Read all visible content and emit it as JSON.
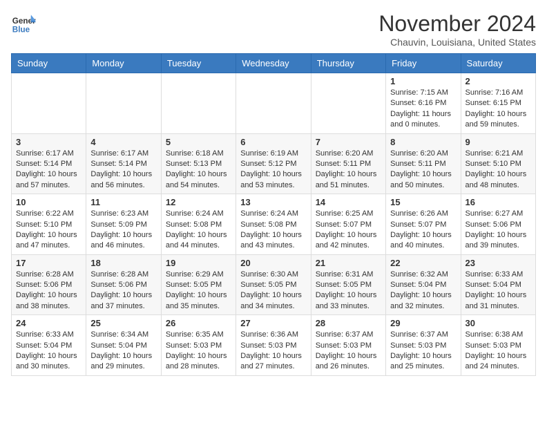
{
  "header": {
    "logo_general": "General",
    "logo_blue": "Blue",
    "month_title": "November 2024",
    "location": "Chauvin, Louisiana, United States"
  },
  "weekdays": [
    "Sunday",
    "Monday",
    "Tuesday",
    "Wednesday",
    "Thursday",
    "Friday",
    "Saturday"
  ],
  "weeks": [
    [
      {
        "day": "",
        "info": ""
      },
      {
        "day": "",
        "info": ""
      },
      {
        "day": "",
        "info": ""
      },
      {
        "day": "",
        "info": ""
      },
      {
        "day": "",
        "info": ""
      },
      {
        "day": "1",
        "info": "Sunrise: 7:15 AM\nSunset: 6:16 PM\nDaylight: 11 hours and 0 minutes."
      },
      {
        "day": "2",
        "info": "Sunrise: 7:16 AM\nSunset: 6:15 PM\nDaylight: 10 hours and 59 minutes."
      }
    ],
    [
      {
        "day": "3",
        "info": "Sunrise: 6:17 AM\nSunset: 5:14 PM\nDaylight: 10 hours and 57 minutes."
      },
      {
        "day": "4",
        "info": "Sunrise: 6:17 AM\nSunset: 5:14 PM\nDaylight: 10 hours and 56 minutes."
      },
      {
        "day": "5",
        "info": "Sunrise: 6:18 AM\nSunset: 5:13 PM\nDaylight: 10 hours and 54 minutes."
      },
      {
        "day": "6",
        "info": "Sunrise: 6:19 AM\nSunset: 5:12 PM\nDaylight: 10 hours and 53 minutes."
      },
      {
        "day": "7",
        "info": "Sunrise: 6:20 AM\nSunset: 5:11 PM\nDaylight: 10 hours and 51 minutes."
      },
      {
        "day": "8",
        "info": "Sunrise: 6:20 AM\nSunset: 5:11 PM\nDaylight: 10 hours and 50 minutes."
      },
      {
        "day": "9",
        "info": "Sunrise: 6:21 AM\nSunset: 5:10 PM\nDaylight: 10 hours and 48 minutes."
      }
    ],
    [
      {
        "day": "10",
        "info": "Sunrise: 6:22 AM\nSunset: 5:10 PM\nDaylight: 10 hours and 47 minutes."
      },
      {
        "day": "11",
        "info": "Sunrise: 6:23 AM\nSunset: 5:09 PM\nDaylight: 10 hours and 46 minutes."
      },
      {
        "day": "12",
        "info": "Sunrise: 6:24 AM\nSunset: 5:08 PM\nDaylight: 10 hours and 44 minutes."
      },
      {
        "day": "13",
        "info": "Sunrise: 6:24 AM\nSunset: 5:08 PM\nDaylight: 10 hours and 43 minutes."
      },
      {
        "day": "14",
        "info": "Sunrise: 6:25 AM\nSunset: 5:07 PM\nDaylight: 10 hours and 42 minutes."
      },
      {
        "day": "15",
        "info": "Sunrise: 6:26 AM\nSunset: 5:07 PM\nDaylight: 10 hours and 40 minutes."
      },
      {
        "day": "16",
        "info": "Sunrise: 6:27 AM\nSunset: 5:06 PM\nDaylight: 10 hours and 39 minutes."
      }
    ],
    [
      {
        "day": "17",
        "info": "Sunrise: 6:28 AM\nSunset: 5:06 PM\nDaylight: 10 hours and 38 minutes."
      },
      {
        "day": "18",
        "info": "Sunrise: 6:28 AM\nSunset: 5:06 PM\nDaylight: 10 hours and 37 minutes."
      },
      {
        "day": "19",
        "info": "Sunrise: 6:29 AM\nSunset: 5:05 PM\nDaylight: 10 hours and 35 minutes."
      },
      {
        "day": "20",
        "info": "Sunrise: 6:30 AM\nSunset: 5:05 PM\nDaylight: 10 hours and 34 minutes."
      },
      {
        "day": "21",
        "info": "Sunrise: 6:31 AM\nSunset: 5:05 PM\nDaylight: 10 hours and 33 minutes."
      },
      {
        "day": "22",
        "info": "Sunrise: 6:32 AM\nSunset: 5:04 PM\nDaylight: 10 hours and 32 minutes."
      },
      {
        "day": "23",
        "info": "Sunrise: 6:33 AM\nSunset: 5:04 PM\nDaylight: 10 hours and 31 minutes."
      }
    ],
    [
      {
        "day": "24",
        "info": "Sunrise: 6:33 AM\nSunset: 5:04 PM\nDaylight: 10 hours and 30 minutes."
      },
      {
        "day": "25",
        "info": "Sunrise: 6:34 AM\nSunset: 5:04 PM\nDaylight: 10 hours and 29 minutes."
      },
      {
        "day": "26",
        "info": "Sunrise: 6:35 AM\nSunset: 5:03 PM\nDaylight: 10 hours and 28 minutes."
      },
      {
        "day": "27",
        "info": "Sunrise: 6:36 AM\nSunset: 5:03 PM\nDaylight: 10 hours and 27 minutes."
      },
      {
        "day": "28",
        "info": "Sunrise: 6:37 AM\nSunset: 5:03 PM\nDaylight: 10 hours and 26 minutes."
      },
      {
        "day": "29",
        "info": "Sunrise: 6:37 AM\nSunset: 5:03 PM\nDaylight: 10 hours and 25 minutes."
      },
      {
        "day": "30",
        "info": "Sunrise: 6:38 AM\nSunset: 5:03 PM\nDaylight: 10 hours and 24 minutes."
      }
    ]
  ]
}
